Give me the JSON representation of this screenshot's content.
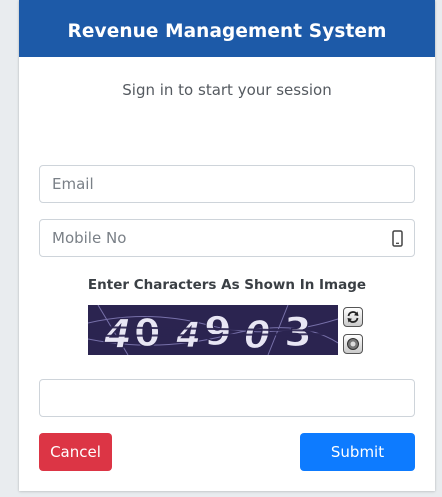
{
  "header": {
    "title": "Revenue Management System"
  },
  "subtitle": "Sign in to start your session",
  "form": {
    "email_placeholder": "Email",
    "mobile_placeholder": "Mobile No",
    "captcha_label": "Enter Characters As Shown In Image",
    "captcha_text": "40 4 903",
    "captcha_input_value": ""
  },
  "buttons": {
    "cancel": "Cancel",
    "submit": "Submit"
  },
  "colors": {
    "header": "#1d5aa8",
    "cancel": "#dc3545",
    "submit": "#0d7bff",
    "captcha_bg": "#2b2450"
  },
  "icons": {
    "mobile": "mobile-phone-icon",
    "refresh": "refresh-icon",
    "audio": "speaker-icon"
  }
}
